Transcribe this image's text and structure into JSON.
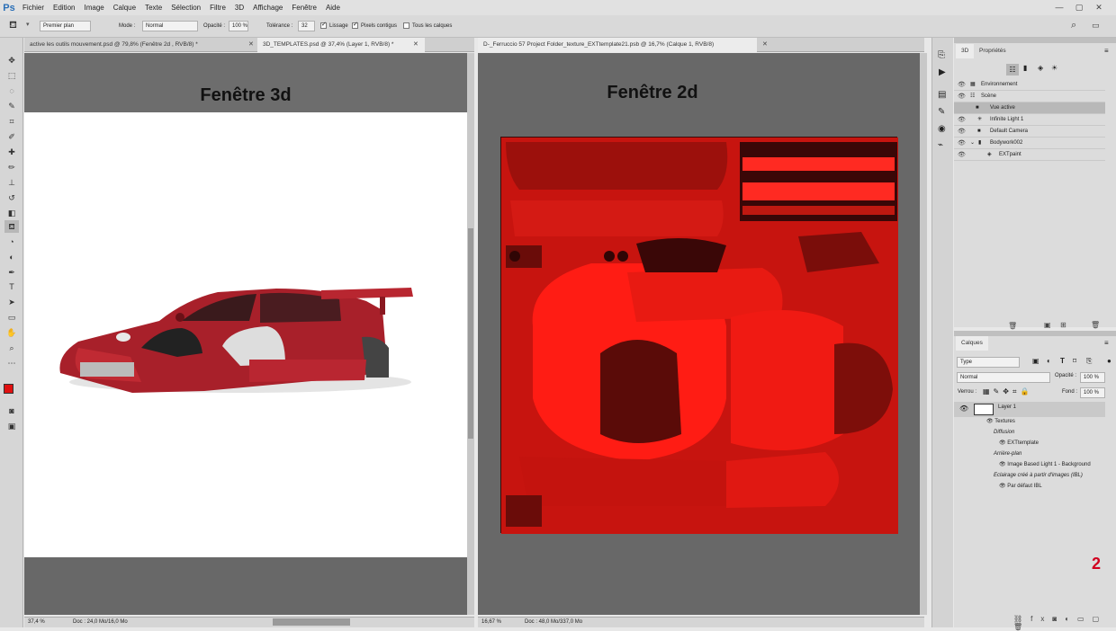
{
  "app": {
    "logo": "Ps"
  },
  "menu": [
    "Fichier",
    "Edition",
    "Image",
    "Calque",
    "Texte",
    "Sélection",
    "Filtre",
    "3D",
    "Affichage",
    "Fenêtre",
    "Aide"
  ],
  "window_controls": [
    "—",
    "▢",
    "✕"
  ],
  "options": {
    "fill_source": "Premier plan",
    "mode_label": "Mode :",
    "mode_value": "Normal",
    "opacity_label": "Opacité :",
    "opacity_value": "100 %",
    "tolerance_label": "Tolérance :",
    "tolerance_value": "32",
    "lissage": "Lissage",
    "pixels_contigus": "Pixels contigus",
    "tous_calques": "Tous les calques"
  },
  "left_doc": {
    "tabs": [
      {
        "label": "active les outils mouvement.psd @ 79,8% (Fenêtre 2d , RVB/8) *"
      },
      {
        "label": "3D_TEMPLATES.psd @ 37,4% (Layer 1, RVB/8) *"
      }
    ],
    "title": "Fenêtre 3d",
    "zoom": "37,4 %",
    "doc_info": "Doc : 24,0 Mo/16,0 Mo"
  },
  "right_doc": {
    "tab": "D-_Ferruccio 57 Project Folder_texture_EXTtemplate21.psb @ 16,7% (Calque 1, RVB/8)",
    "title": "Fenêtre 2d",
    "zoom": "16,67 %",
    "doc_info": "Doc : 48,0 Mo/337,0 Mo"
  },
  "panel_3d": {
    "tabs": [
      "3D",
      "Propriétés"
    ],
    "items": [
      {
        "label": "Environnement",
        "indent": 0
      },
      {
        "label": "Scène",
        "indent": 0
      },
      {
        "label": "Vue active",
        "indent": 1
      },
      {
        "label": "Infinite Light 1",
        "indent": 1
      },
      {
        "label": "Default Camera",
        "indent": 1
      },
      {
        "label": "Bodywork002",
        "indent": 1
      },
      {
        "label": "EXTpaint",
        "indent": 2
      }
    ]
  },
  "layers_panel": {
    "tab": "Calques",
    "filter": "Type",
    "blend_mode": "Normal",
    "opacity_label": "Opacité :",
    "opacity_value": "100 %",
    "lock_label": "Verrou :",
    "fill_label": "Fond :",
    "fill_value": "100 %",
    "layer_name": "Layer 1",
    "sub": [
      "Textures",
      "Diffusion",
      "EXTtemplate",
      "Arrière-plan",
      "Image Based Light 1 - Background",
      "Eclairage créé à partir d'images (IBL)",
      "Par défaut IBL"
    ]
  },
  "annotation": "2",
  "colors": {
    "texture_red": "#e0140f",
    "fg_swatch": "#e01010"
  }
}
